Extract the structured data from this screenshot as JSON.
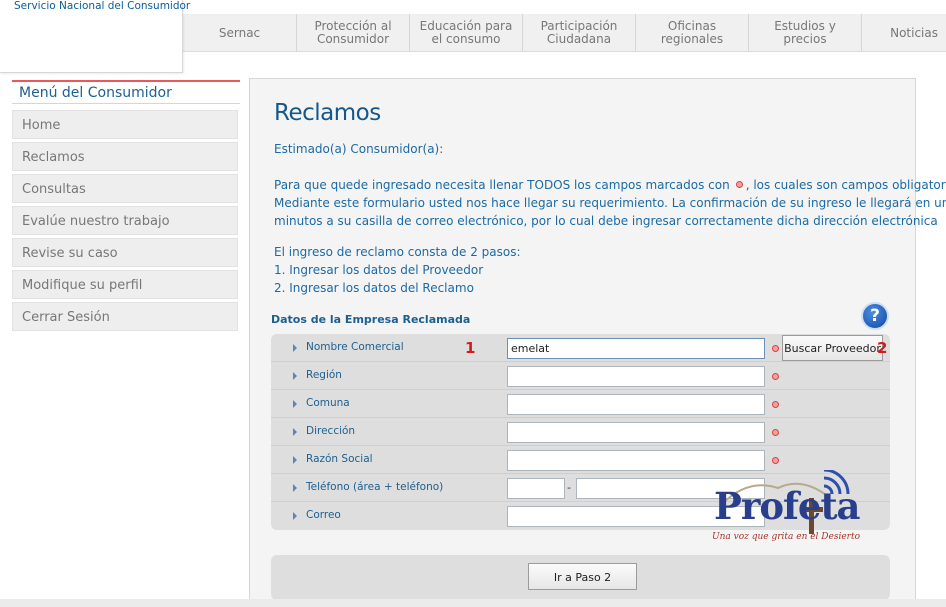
{
  "brand": {
    "name": "Servicio Nacional del Consumidor"
  },
  "nav": {
    "items": [
      {
        "label": "Sernac"
      },
      {
        "label": "Protección al\nConsumidor"
      },
      {
        "label": "Educación para\nel consumo"
      },
      {
        "label": "Participación\nCiudadana"
      },
      {
        "label": "Oficinas\nregionales"
      },
      {
        "label": "Estudios y\nprecios"
      },
      {
        "label": "Noticias"
      }
    ]
  },
  "sidebar": {
    "title": "Menú del Consumidor",
    "items": [
      {
        "label": "Home"
      },
      {
        "label": "Reclamos"
      },
      {
        "label": "Consultas"
      },
      {
        "label": "Evalúe nuestro trabajo"
      },
      {
        "label": "Revise su caso"
      },
      {
        "label": "Modifique su perfil"
      },
      {
        "label": "Cerrar Sesión"
      }
    ]
  },
  "main": {
    "title": "Reclamos",
    "greeting": "Estimado(a) Consumidor(a):",
    "intro_line1_a": "Para que quede ingresado necesita llenar TODOS los campos marcados con",
    "intro_line1_b": ", los cuales son campos obligatorios.",
    "intro_line2": "Mediante este formulario usted nos hace llegar su requerimiento. La confirmación de su ingreso le llegará en unos",
    "intro_line3": "minutos a su casilla de correo electrónico, por lo cual debe ingresar correctamente dicha dirección electrónica",
    "steps_intro": "El ingreso de reclamo consta de 2 pasos:",
    "step1": "1. Ingresar los datos del Proveedor",
    "step2": "2. Ingresar los datos del Reclamo",
    "section_title": "Datos de la Empresa Reclamada",
    "help_glyph": "?"
  },
  "form": {
    "fields": [
      {
        "label": "Nombre Comercial",
        "value": "emelat"
      },
      {
        "label": "Región",
        "value": ""
      },
      {
        "label": "Comuna",
        "value": ""
      },
      {
        "label": "Dirección",
        "value": ""
      },
      {
        "label": "Razón Social",
        "value": ""
      },
      {
        "label": "Teléfono (área + teléfono)",
        "area": "",
        "number": "",
        "separator": "-"
      },
      {
        "label": "Correo",
        "value": ""
      }
    ],
    "search_button": "Buscar Proveedor",
    "next_button": "Ir a Paso 2",
    "markers": [
      "1",
      "2"
    ]
  },
  "watermark": {
    "title": "Profeta",
    "subtitle": "Una voz que grita en el Desierto"
  },
  "colors": {
    "brand_blue": "#14578a",
    "link_blue": "#1c6aa3",
    "required_red": "#e04040",
    "marker_red": "#d61a1a"
  }
}
